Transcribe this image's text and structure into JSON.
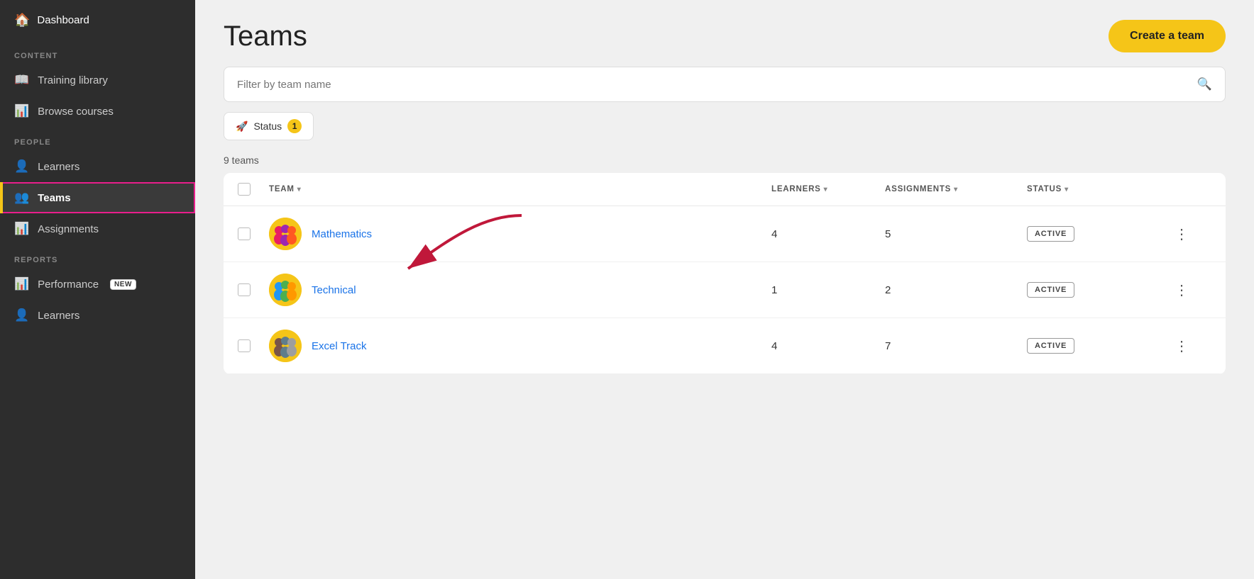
{
  "sidebar": {
    "logo": {
      "icon": "🏠",
      "label": "Dashboard"
    },
    "sections": [
      {
        "label": "CONTENT",
        "items": [
          {
            "id": "training-library",
            "icon": "📖",
            "label": "Training library",
            "active": false
          },
          {
            "id": "browse-courses",
            "icon": "📊",
            "label": "Browse courses",
            "active": false
          }
        ]
      },
      {
        "label": "PEOPLE",
        "items": [
          {
            "id": "learners",
            "icon": "👤",
            "label": "Learners",
            "active": false
          },
          {
            "id": "teams",
            "icon": "👥",
            "label": "Teams",
            "active": true
          }
        ]
      },
      {
        "label": "",
        "items": [
          {
            "id": "assignments",
            "icon": "📊",
            "label": "Assignments",
            "active": false
          }
        ]
      },
      {
        "label": "REPORTS",
        "items": [
          {
            "id": "performance",
            "icon": "📊",
            "label": "Performance",
            "badge": "NEW",
            "active": false
          },
          {
            "id": "learners-reports",
            "icon": "👤",
            "label": "Learners",
            "active": false
          }
        ]
      }
    ]
  },
  "page": {
    "title": "Teams",
    "create_button_label": "Create a team",
    "search_placeholder": "Filter by team name",
    "teams_count": "9 teams",
    "filter_label": "Status",
    "filter_badge": "1"
  },
  "table": {
    "headers": [
      {
        "id": "team",
        "label": "TEAM"
      },
      {
        "id": "learners",
        "label": "LEARNERS"
      },
      {
        "id": "assignments",
        "label": "ASSIGNMENTS"
      },
      {
        "id": "status",
        "label": "STATUS"
      }
    ],
    "rows": [
      {
        "id": 1,
        "name": "Mathematics",
        "learners": "4",
        "assignments": "5",
        "status": "ACTIVE",
        "avatar": "👨‍👩‍👧‍👦"
      },
      {
        "id": 2,
        "name": "Technical",
        "learners": "1",
        "assignments": "2",
        "status": "ACTIVE",
        "avatar": "👨‍👩‍👧‍👦"
      },
      {
        "id": 3,
        "name": "Excel Track",
        "learners": "4",
        "assignments": "7",
        "status": "ACTIVE",
        "avatar": "👨‍👩‍👧‍👦"
      }
    ]
  }
}
